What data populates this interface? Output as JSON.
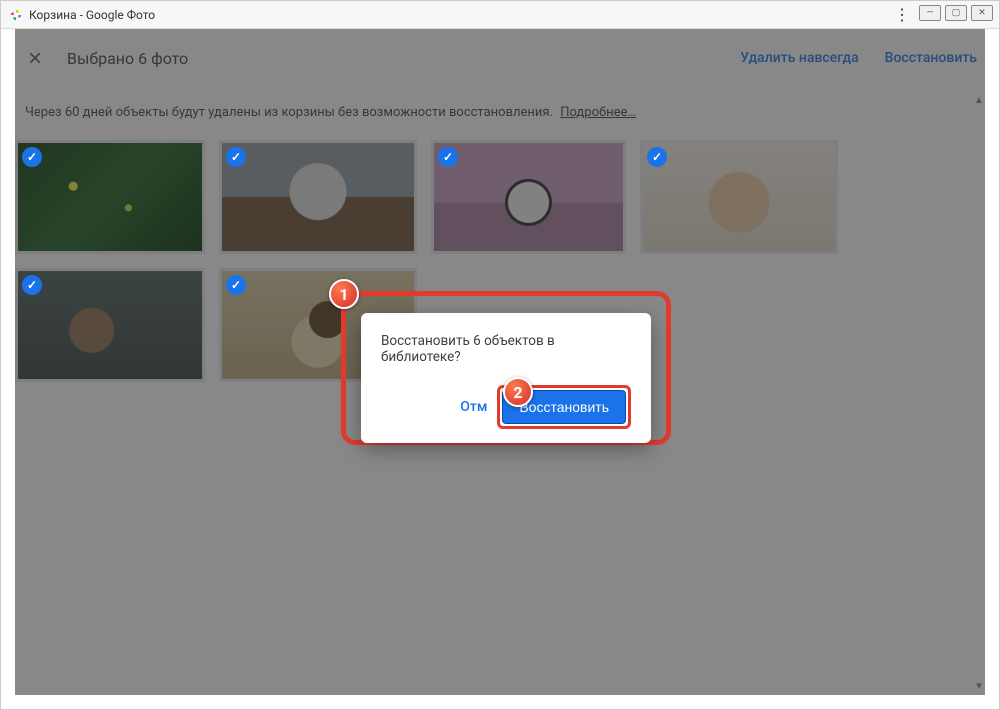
{
  "window": {
    "title": "Корзина - Google Фото"
  },
  "header": {
    "selection_text": "Выбрано 6 фото",
    "delete_forever": "Удалить навсегда",
    "restore": "Восстановить"
  },
  "info": {
    "text": "Через 60 дней объекты будут удалены из корзины без возможности восстановления.",
    "more": "Подробнее…"
  },
  "dialog": {
    "message": "Восстановить 6 объектов в библиотеке?",
    "cancel_partial": "Отм",
    "restore": "Восстановить"
  },
  "steps": {
    "one": "1",
    "two": "2"
  }
}
